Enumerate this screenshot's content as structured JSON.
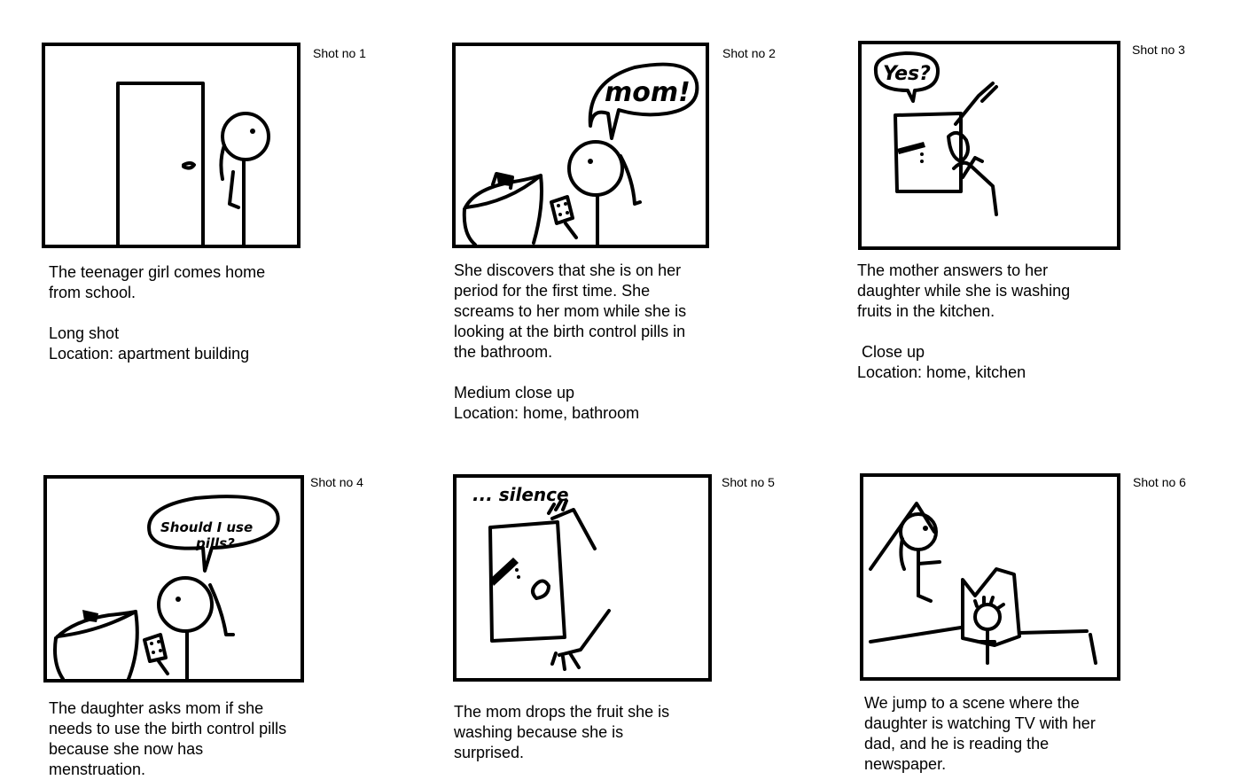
{
  "shots": [
    {
      "label": "Shot no 1",
      "lines": [
        "The teenager girl comes home",
        "from school.",
        "",
        "Long shot",
        "Location: apartment building"
      ]
    },
    {
      "label": "Shot no 2",
      "bubble": "mom!",
      "lines": [
        "She discovers that she is on her",
        "period for the first time. She",
        "screams to her mom while she is",
        "looking at the birth control pills in",
        "the bathroom.",
        "",
        "Medium close up",
        "Location: home, bathroom"
      ]
    },
    {
      "label": "Shot no 3",
      "bubble": "Yes?",
      "lines": [
        "The mother answers to her",
        "daughter while she is washing",
        "fruits in the kitchen.",
        "",
        " Close up",
        "Location: home, kitchen"
      ]
    },
    {
      "label": "Shot no 4",
      "bubble_line1": "Should I use",
      "bubble_line2": "pills?",
      "lines": [
        "The daughter asks mom if she",
        "needs to use the birth control pills",
        "because she now has",
        "menstruation."
      ]
    },
    {
      "label": "Shot no 5",
      "caption": "... silence",
      "lines": [
        "The mom drops the fruit she is",
        "washing because she is",
        "surprised."
      ]
    },
    {
      "label": "Shot no 6",
      "lines": [
        "We jump to a scene where the",
        "daughter is watching TV with her",
        "dad, and he is reading the",
        "newspaper."
      ]
    }
  ]
}
